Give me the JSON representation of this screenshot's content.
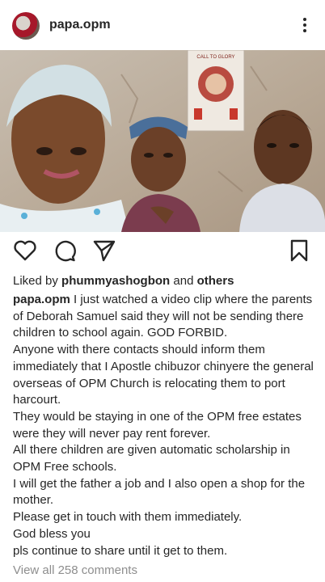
{
  "post": {
    "username": "papa.opm",
    "liked_by_prefix": "Liked by ",
    "liked_by_user": "phummyashogbon",
    "liked_by_and": " and ",
    "liked_by_others": "others",
    "caption_username": "papa.opm",
    "caption_text": " I just watched a video clip where the parents of Deborah Samuel said they will not be sending there children to school again. GOD FORBID.\nAnyone with there contacts should inform them immediately that I Apostle chibuzor chinyere the general overseas of OPM Church is relocating them to port harcourt.\nThey would be staying in one of the OPM free estates were they will never pay rent forever.\nAll there children are given automatic scholarship in OPM Free schools.\nI will get the father a job and I also open a shop for the mother.\nPlease get in touch with them immediately.\nGod bless you\npls continue to share until it get to them.",
    "view_comments": "View all 258 comments",
    "poster_text": "CALL TO GLORY"
  },
  "icons": {
    "avatar": "profile-avatar",
    "more": "more-vertical-icon",
    "like": "heart-icon",
    "comment": "comment-icon",
    "share": "send-icon",
    "save": "bookmark-icon"
  }
}
